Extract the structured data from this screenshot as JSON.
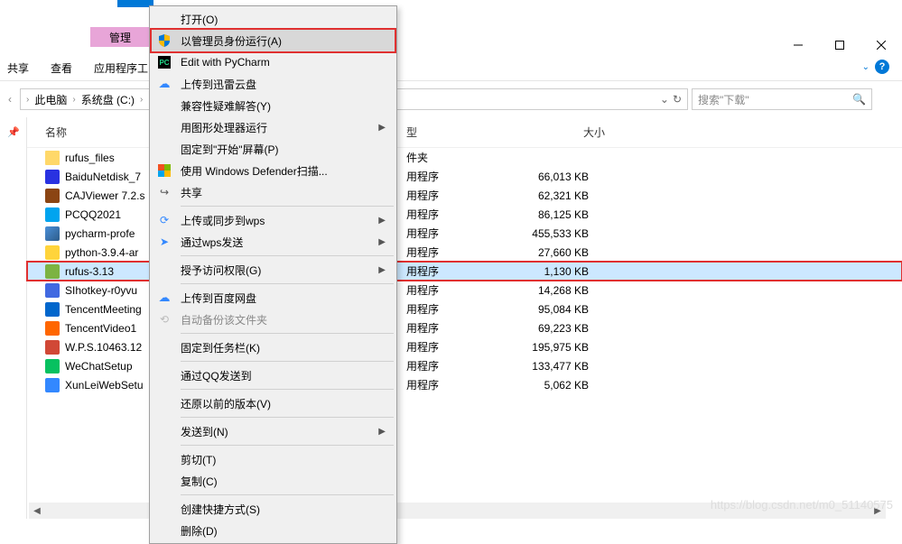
{
  "tab_label": "管理",
  "toolbar": {
    "share": "共享",
    "view": "查看",
    "apps": "应用程序工"
  },
  "breadcrumb": {
    "pc": "此电脑",
    "drive": "系统盘 (C:)"
  },
  "search_placeholder": "搜索\"下载\"",
  "columns": {
    "name": "名称",
    "type": "型",
    "size": "大小"
  },
  "files": [
    {
      "name": "rufus_files",
      "type": "件夹",
      "size": "",
      "icon": "icon-folder"
    },
    {
      "name": "BaiduNetdisk_7",
      "type": "用程序",
      "size": "66,013 KB",
      "icon": "icon-baidu"
    },
    {
      "name": "CAJViewer 7.2.s",
      "type": "用程序",
      "size": "62,321 KB",
      "icon": "icon-caj"
    },
    {
      "name": "PCQQ2021",
      "type": "用程序",
      "size": "86,125 KB",
      "icon": "icon-pc"
    },
    {
      "name": "pycharm-profe",
      "type": "用程序",
      "size": "455,533 KB",
      "icon": "icon-exe"
    },
    {
      "name": "python-3.9.4-ar",
      "type": "用程序",
      "size": "27,660 KB",
      "icon": "icon-py"
    },
    {
      "name": "rufus-3.13",
      "type": "用程序",
      "size": "1,130 KB",
      "icon": "icon-rufus"
    },
    {
      "name": "SIhotkey-r0yvu",
      "type": "用程序",
      "size": "14,268 KB",
      "icon": "icon-si"
    },
    {
      "name": "TencentMeeting",
      "type": "用程序",
      "size": "95,084 KB",
      "icon": "icon-tc"
    },
    {
      "name": "TencentVideo1",
      "type": "用程序",
      "size": "69,223 KB",
      "icon": "icon-tv"
    },
    {
      "name": "W.P.S.10463.12",
      "type": "用程序",
      "size": "195,975 KB",
      "icon": "icon-wps"
    },
    {
      "name": "WeChatSetup",
      "type": "用程序",
      "size": "133,477 KB",
      "icon": "icon-wx"
    },
    {
      "name": "XunLeiWebSetu",
      "type": "用程序",
      "size": "5,062 KB",
      "icon": "icon-xl"
    }
  ],
  "selected_index": 6,
  "context_menu": {
    "open": "打开(O)",
    "run_admin": "以管理员身份运行(A)",
    "pycharm": "Edit with PyCharm",
    "xunlei": "上传到迅雷云盘",
    "compat": "兼容性疑难解答(Y)",
    "graphics": "用图形处理器运行",
    "pin_start": "固定到\"开始\"屏幕(P)",
    "defender": "使用 Windows Defender扫描...",
    "share": "共享",
    "wps_sync": "上传或同步到wps",
    "wps_send": "通过wps发送",
    "grant_access": "授予访问权限(G)",
    "baidu_upload": "上传到百度网盘",
    "auto_backup": "自动备份该文件夹",
    "pin_taskbar": "固定到任务栏(K)",
    "qq_send": "通过QQ发送到",
    "restore": "还原以前的版本(V)",
    "send_to": "发送到(N)",
    "cut": "剪切(T)",
    "copy": "复制(C)",
    "shortcut": "创建快捷方式(S)",
    "delete": "删除(D)"
  },
  "watermark": "https://blog.csdn.net/m0_51140575"
}
